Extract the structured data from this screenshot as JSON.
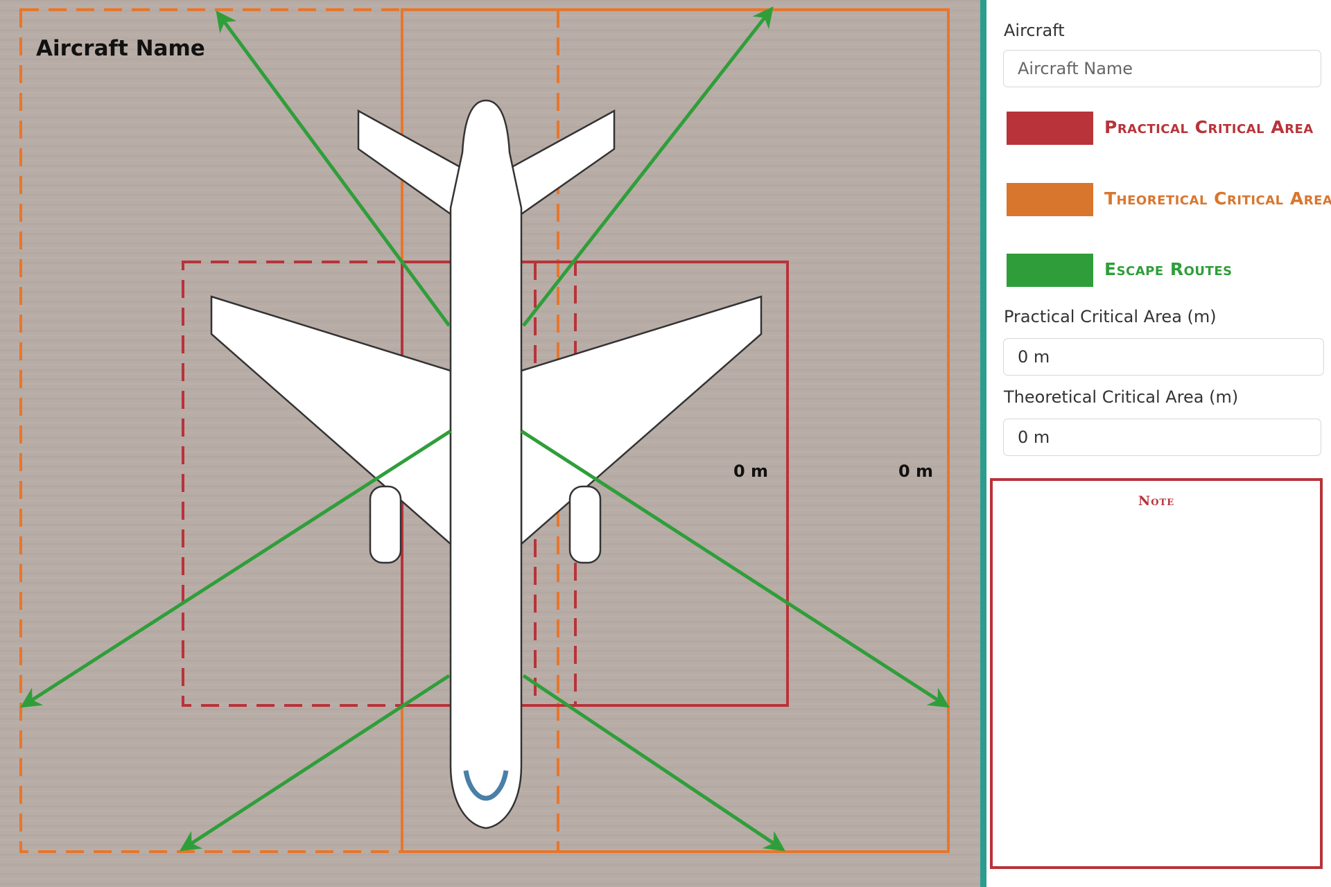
{
  "diagram": {
    "aircraft_name": "Aircraft Name",
    "practical_distance": "0 m",
    "theoretical_distance": "0 m"
  },
  "form": {
    "aircraft_label": "Aircraft",
    "aircraft_placeholder": "Aircraft Name",
    "practical_label": "Practical Critical Area (m)",
    "practical_value": "0 m",
    "theoretical_label": "Theoretical Critical Area (m)",
    "theoretical_value": "0 m"
  },
  "legend": [
    {
      "label": "Practical Critical Area",
      "color": "#b8333a"
    },
    {
      "label": "Theoretical Critical Area",
      "color": "#d9762e"
    },
    {
      "label": "Escape Routes",
      "color": "#2f9e3a"
    }
  ],
  "note": {
    "title": "Note",
    "text": ""
  },
  "colors": {
    "practical": "#b8333a",
    "theoretical": "#e8762a",
    "escape": "#2f9e3a",
    "divider": "#2a9d8f"
  }
}
